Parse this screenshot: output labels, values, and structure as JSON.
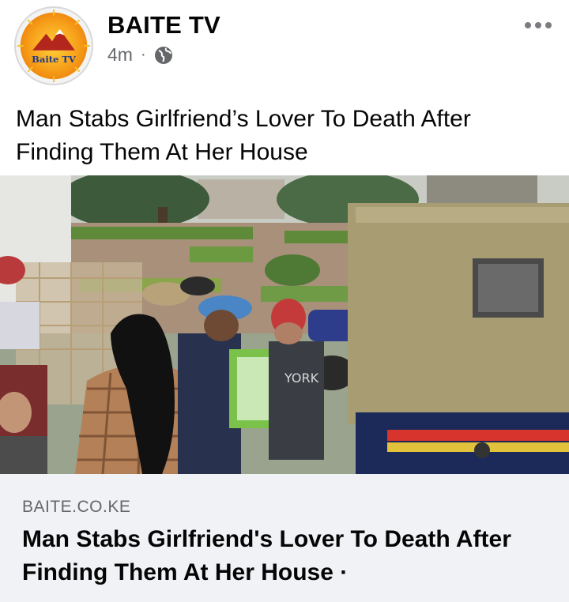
{
  "post": {
    "page_name": "BAITE TV",
    "timestamp": "4m",
    "separator": "·",
    "privacy_icon": "globe-icon",
    "more_icon": "more-horizontal-icon",
    "avatar_text": "Baite TV",
    "caption": "Man Stabs Girlfriend’s Lover To Death After Finding Them At Her House"
  },
  "link_preview": {
    "domain": "BAITE.CO.KE",
    "title": "Man Stabs Girlfriend's Lover To Death After Finding Them At Her House ·",
    "image_text": "YORK"
  },
  "colors": {
    "link_box_bg": "#f0f2f5",
    "meta_grey": "#65676b",
    "police_truck_canvas": "#a89c72",
    "police_stripe_red": "#d6342c",
    "police_stripe_yellow": "#e2c23a"
  }
}
